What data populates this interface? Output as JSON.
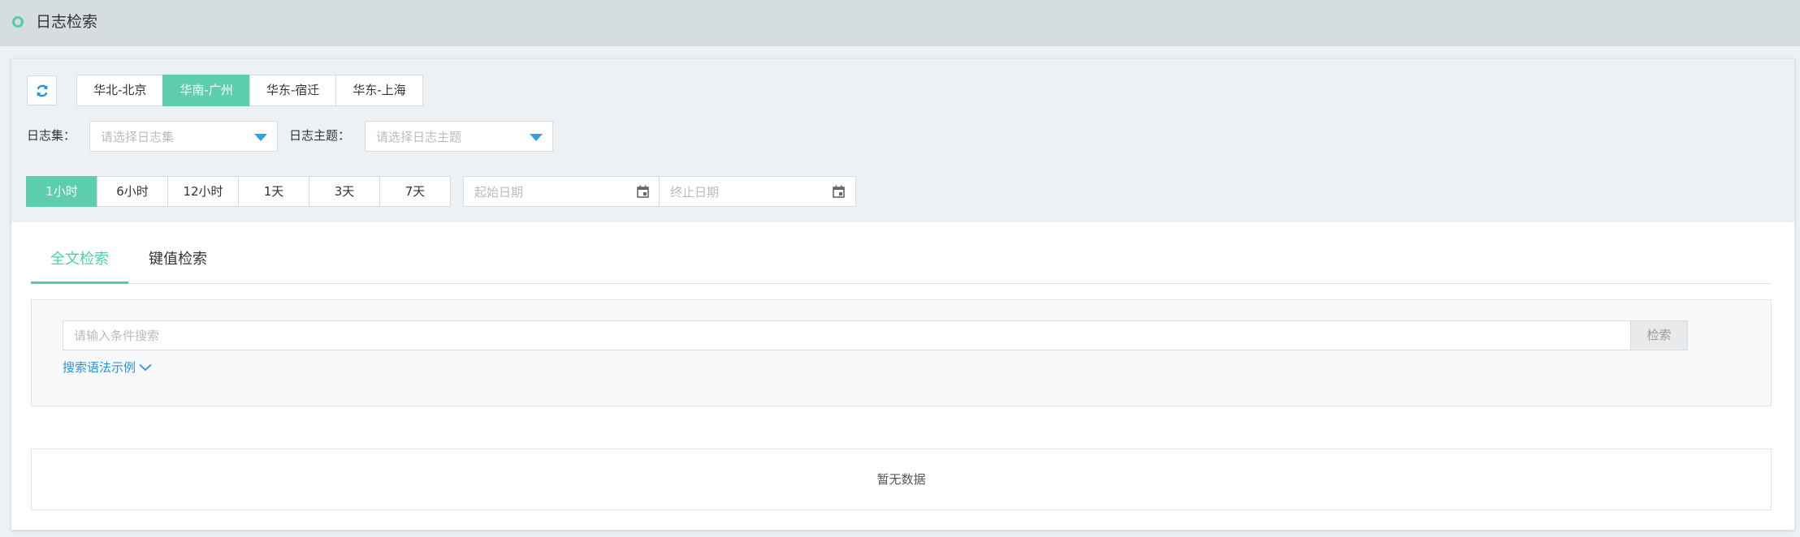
{
  "page": {
    "title": "日志检索"
  },
  "regions": [
    {
      "label": "华北-北京",
      "active": false
    },
    {
      "label": "华南-广州",
      "active": true
    },
    {
      "label": "华东-宿迁",
      "active": false
    },
    {
      "label": "华东-上海",
      "active": false
    }
  ],
  "filters": {
    "logset_label": "日志集：",
    "logset_placeholder": "请选择日志集",
    "topic_label": "日志主题：",
    "topic_placeholder": "请选择日志主题"
  },
  "time_ranges": [
    {
      "label": "1小时",
      "active": true
    },
    {
      "label": "6小时",
      "active": false
    },
    {
      "label": "12小时",
      "active": false
    },
    {
      "label": "1天",
      "active": false
    },
    {
      "label": "3天",
      "active": false
    },
    {
      "label": "7天",
      "active": false
    }
  ],
  "dates": {
    "start_placeholder": "起始日期",
    "end_placeholder": "终止日期"
  },
  "tabs": [
    {
      "label": "全文检索",
      "active": true
    },
    {
      "label": "键值检索",
      "active": false
    }
  ],
  "search": {
    "placeholder": "请输入条件搜索",
    "button_label": "检索",
    "syntax_link": "搜索语法示例"
  },
  "results": {
    "empty_text": "暂无数据"
  },
  "colors": {
    "accent": "#5dcfae",
    "link": "#2b93dd",
    "caret": "#2ba3e6"
  },
  "icons": {
    "refresh": "refresh-icon",
    "calendar": "calendar-icon",
    "caret": "caret-down-icon",
    "chevron": "chevron-down-icon",
    "title_marker": "circle-icon"
  }
}
